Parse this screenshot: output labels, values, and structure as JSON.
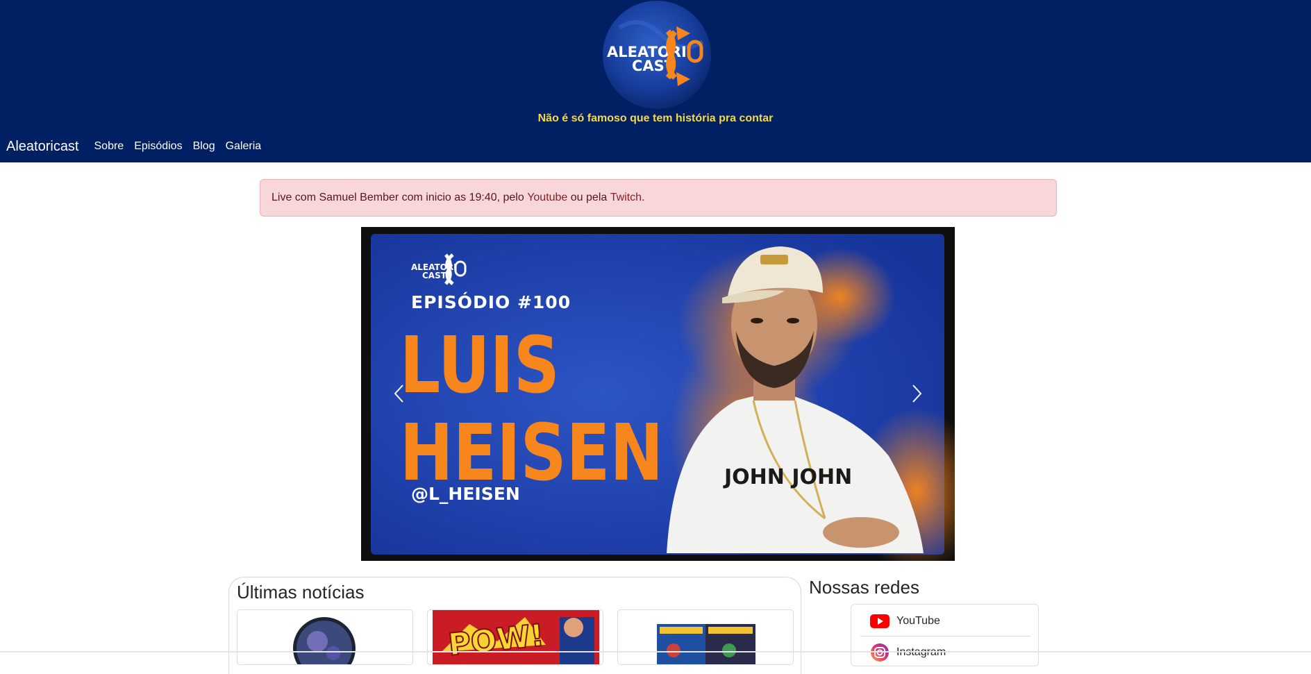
{
  "header": {
    "logo_text_line1": "ALEATORI",
    "logo_text_line2": "CAST",
    "tagline": "Não é só famoso que tem história pra contar"
  },
  "nav": {
    "brand": "Aleatoricast",
    "items": [
      {
        "label": "Sobre"
      },
      {
        "label": "Episódios"
      },
      {
        "label": "Blog"
      },
      {
        "label": "Galeria"
      }
    ]
  },
  "alert": {
    "text_before": "Live com Samuel Bember com inicio as 19:40, pelo ",
    "link_youtube": "Youtube",
    "text_middle": " ou pela ",
    "link_twitch": "Twitch",
    "text_after": "."
  },
  "carousel": {
    "slide": {
      "logo_text_line1": "ALEATORI",
      "logo_text_line2": "CAST",
      "episode": "EPISÓDIO #100",
      "name_line1": "LUIS",
      "name_line2": "HEISEN",
      "handle": "@L_HEISEN",
      "shirt_text": "JOHN JOHN"
    }
  },
  "news": {
    "title": "Últimas notícias",
    "card2_text": "POW!"
  },
  "social": {
    "title": "Nossas redes",
    "items": [
      {
        "label": "YouTube",
        "icon": "youtube-icon"
      },
      {
        "label": "Instagram",
        "icon": "instagram-icon"
      }
    ]
  },
  "colors": {
    "header_bg": "#002063",
    "tagline": "#f5d94a",
    "alert_bg": "#f8d7da",
    "accent_orange": "#f7861c"
  }
}
